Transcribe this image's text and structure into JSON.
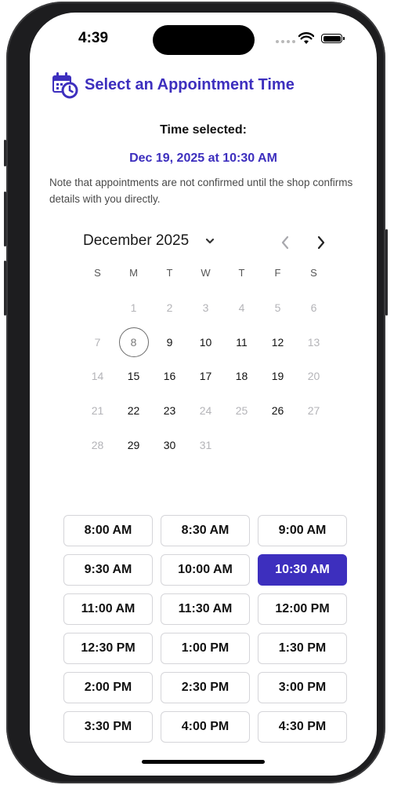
{
  "status_bar": {
    "time": "4:39",
    "icons": [
      "signal-dots-icon",
      "wifi-icon",
      "battery-icon"
    ]
  },
  "header": {
    "icon": "calendar-clock-icon",
    "title": "Select an Appointment Time"
  },
  "selection": {
    "label": "Time selected:",
    "value": "Dec 19, 2025 at 10:30 AM"
  },
  "note": "Note that appointments are not confirmed until the shop confirms details with you directly.",
  "calendar": {
    "month_label": "December 2025",
    "weekdays": [
      "S",
      "M",
      "T",
      "W",
      "T",
      "F",
      "S"
    ],
    "weeks": [
      [
        "",
        "1",
        "2",
        "3",
        "4",
        "5",
        "6"
      ],
      [
        "7",
        "8",
        "9",
        "10",
        "11",
        "12",
        "13"
      ],
      [
        "14",
        "15",
        "16",
        "17",
        "18",
        "19",
        "20"
      ],
      [
        "21",
        "22",
        "23",
        "24",
        "25",
        "26",
        "27"
      ],
      [
        "28",
        "29",
        "30",
        "31",
        "",
        "",
        ""
      ]
    ],
    "today": "8",
    "available_days": [
      "9",
      "10",
      "11",
      "12",
      "15",
      "16",
      "17",
      "18",
      "19",
      "22",
      "23",
      "26",
      "29",
      "30"
    ]
  },
  "time_slots": [
    "8:00 AM",
    "8:30 AM",
    "9:00 AM",
    "9:30 AM",
    "10:00 AM",
    "10:30 AM",
    "11:00 AM",
    "11:30 AM",
    "12:00 PM",
    "12:30 PM",
    "1:00 PM",
    "1:30 PM",
    "2:00 PM",
    "2:30 PM",
    "3:00 PM",
    "3:30 PM",
    "4:00 PM",
    "4:30 PM"
  ],
  "selected_slot": "10:30 AM",
  "colors": {
    "accent": "#3d2fbe",
    "text": "#111111",
    "dim": "#b4b4b8",
    "slot_border": "#d5d5d9"
  }
}
